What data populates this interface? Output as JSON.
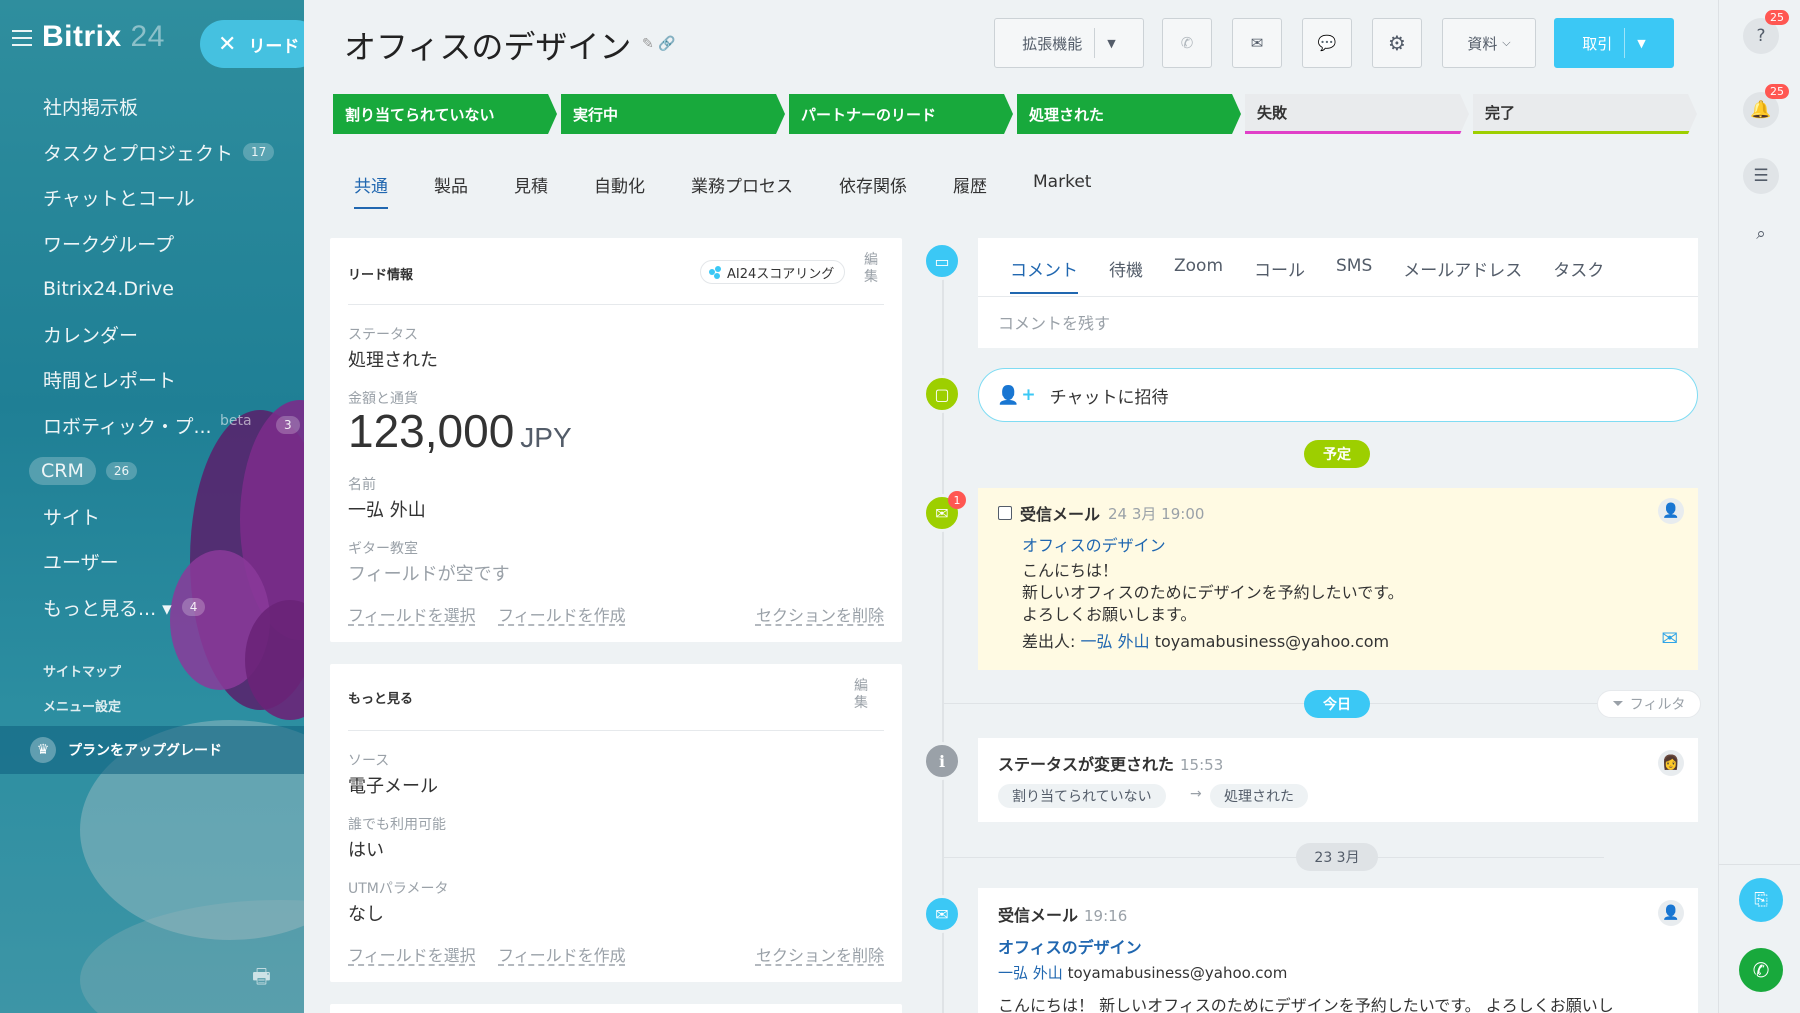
{
  "sidebar": {
    "logo_main": "Bitrix",
    "logo_num": "24",
    "lead_pill": "リード",
    "items": [
      {
        "label": "社内掲示板",
        "count": ""
      },
      {
        "label": "タスクとプロジェクト",
        "count": "17"
      },
      {
        "label": "チャットとコール",
        "count": ""
      },
      {
        "label": "ワークグループ",
        "count": ""
      },
      {
        "label": "Bitrix24.Drive",
        "count": ""
      },
      {
        "label": "カレンダー",
        "count": ""
      },
      {
        "label": "時間とレポート",
        "count": ""
      },
      {
        "label": "ロボティック・プ...",
        "count": "3",
        "tag": "beta"
      },
      {
        "label": "CRM",
        "count": "26"
      },
      {
        "label": "サイト",
        "count": ""
      },
      {
        "label": "ユーザー",
        "count": ""
      },
      {
        "label": "もっと見る... ▾",
        "count": "4"
      }
    ],
    "sitemap": "サイトマップ",
    "menu_settings": "メニュー設定",
    "upgrade": "プランをアップグレード"
  },
  "header": {
    "title": "オフィスのデザイン",
    "extensions": "拡張機能",
    "documents": "資料",
    "deal": "取引"
  },
  "stages": [
    {
      "label": "割り当てられていない",
      "state": "done"
    },
    {
      "label": "実行中",
      "state": "done"
    },
    {
      "label": "パートナーのリード",
      "state": "done"
    },
    {
      "label": "処理された",
      "state": "done"
    },
    {
      "label": "失敗",
      "state": "fail",
      "accent": "#e040c8"
    },
    {
      "label": "完了",
      "state": "success",
      "accent": "#9dcf00"
    }
  ],
  "tabs": [
    "共通",
    "製品",
    "見積",
    "自動化",
    "業務プロセス",
    "依存関係",
    "履歴",
    "Market"
  ],
  "lead_info": {
    "title": "リード情報",
    "ai_scoring": "AI24スコアリング",
    "edit": "編集",
    "status_label": "ステータス",
    "status_value": "処理された",
    "amount_label": "金額と通貨",
    "amount": "123,000",
    "currency": "JPY",
    "name_label": "名前",
    "name_value": "一弘 外山",
    "company_label": "ギター教室",
    "company_value": "フィールドが空です",
    "select_field": "フィールドを選択",
    "create_field": "フィールドを作成",
    "delete_section": "セクションを削除"
  },
  "more_info": {
    "title": "もっと見る",
    "edit": "編集",
    "source_label": "ソース",
    "source_value": "電子メール",
    "available_label": "誰でも利用可能",
    "available_value": "はい",
    "utm_label": "UTMパラメータ",
    "utm_value": "なし",
    "select_field": "フィールドを選択",
    "create_field": "フィールドを作成",
    "delete_section": "セクションを削除"
  },
  "timeline": {
    "composer_tabs": [
      "コメント",
      "待機",
      "Zoom",
      "コール",
      "SMS",
      "メールアドレス",
      "タスク"
    ],
    "comment_placeholder": "コメントを残す",
    "invite_chat": "チャットに招待",
    "planned": "予定",
    "mail_notif_count": "1",
    "mail1": {
      "type": "受信メール",
      "time": "24 3月 19:00",
      "subject": "オフィスのデザイン",
      "lines": [
        "こんにちは！",
        "新しいオフィスのためにデザインを予約したいです。",
        "よろしくお願いします。"
      ],
      "from_label": "差出人:",
      "from_name": "一弘 外山",
      "from_email": "toyamabusiness@yahoo.com"
    },
    "today": "今日",
    "filter": "フィルタ",
    "status_change": {
      "title": "ステータスが変更された",
      "time": "15:53",
      "from": "割り当てられていない",
      "to": "処理された"
    },
    "date_divider": "23 3月",
    "mail2": {
      "type": "受信メール",
      "time": "19:16",
      "subject": "オフィスのデザイン",
      "from_name": "一弘 外山",
      "from_email": "toyamabusiness@yahoo.com",
      "body": "こんにちは！ 新しいオフィスのためにデザインを予約したいです。 よろしくお願いし"
    }
  },
  "rail": {
    "help_badge": "25",
    "notify_badge": "25"
  }
}
